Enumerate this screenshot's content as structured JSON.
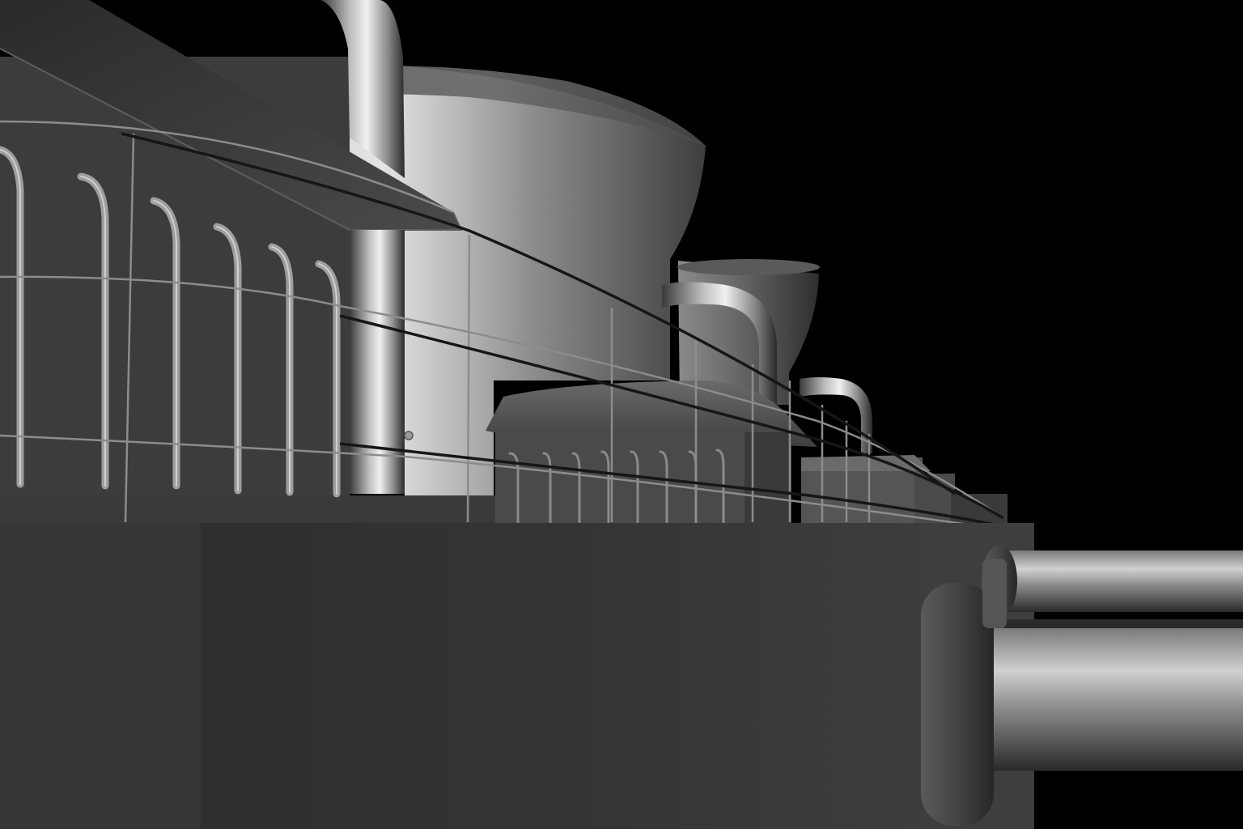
{
  "scene": {
    "subject": "rendered-3d-industrial-structure",
    "render_style": "grayscale-untextured-3d-render",
    "colors": {
      "background": "#000000",
      "hull_base": "#3a3a3a",
      "hull_side": "#2e2e2e",
      "deck_wall": "#404040",
      "stack_light": "#d8d8d8",
      "stack_mid": "#8a8a8a",
      "stack_dark": "#3c3c3c",
      "pipe_highlight": "#e6e6e6",
      "pipe_mid": "#9a9a9a",
      "pipe_shadow": "#2a2a2a",
      "rail": "#a8a8a8",
      "cable": "#1a1a1a"
    },
    "objects": {
      "main_stack": "conical-stack",
      "rear_stack": "conical-stack",
      "pipes": "curved-pipes",
      "railing": "deck-railing",
      "deckhouse": "deckhouse",
      "side_tubes": "horizontal-tubes"
    }
  }
}
